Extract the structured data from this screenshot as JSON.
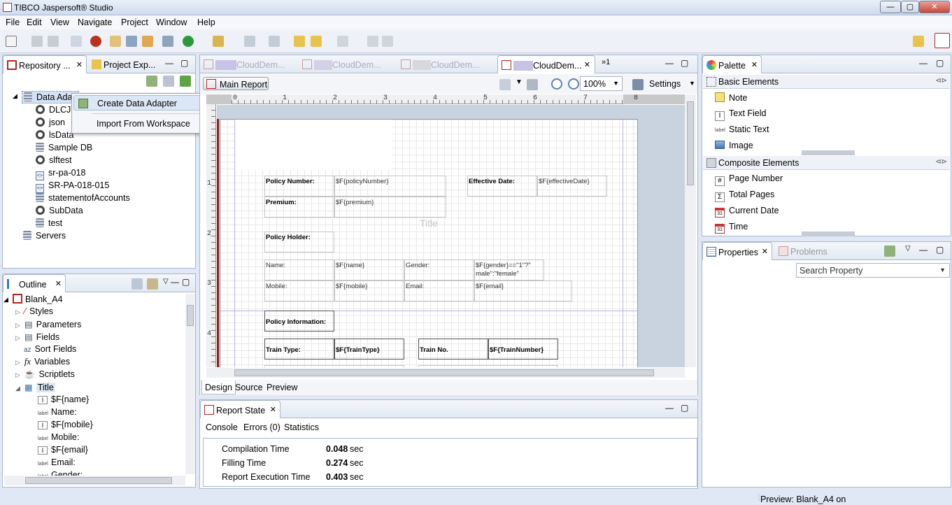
{
  "window": {
    "title": "TIBCO Jaspersoft® Studio",
    "buttons": [
      "—",
      "▢",
      "✕"
    ]
  },
  "menu": [
    "File",
    "Edit",
    "View",
    "Navigate",
    "Project",
    "Window",
    "Help"
  ],
  "repository": {
    "tabs": [
      "Repository ...",
      "Project Exp..."
    ],
    "items": [
      {
        "label": "Data Adap",
        "icon": "db"
      },
      {
        "label": "DLCJS",
        "icon": "ring"
      },
      {
        "label": "json",
        "icon": "ring"
      },
      {
        "label": "lsData",
        "icon": "ring"
      },
      {
        "label": "Sample DB",
        "icon": "db"
      },
      {
        "label": "slftest",
        "icon": "ring"
      },
      {
        "label": "sr-pa-018",
        "icon": "xml"
      },
      {
        "label": "SR-PA-018-015",
        "icon": "xml"
      },
      {
        "label": "statementofAccounts",
        "icon": "db"
      },
      {
        "label": "SubData",
        "icon": "ring"
      },
      {
        "label": "test",
        "icon": "db"
      },
      {
        "label": "Servers",
        "icon": "db"
      }
    ]
  },
  "context_menu": [
    "Create Data Adapter",
    "Import From Workspace"
  ],
  "outline": {
    "tab": "Outline",
    "root": "Blank_A4",
    "items": [
      "Styles",
      "Parameters",
      "Fields",
      "Sort Fields",
      "Variables",
      "Scriptlets",
      "Title"
    ],
    "title_children": [
      {
        "icon": "text",
        "label": "$F{name}"
      },
      {
        "icon": "label",
        "label": "Name:"
      },
      {
        "icon": "text",
        "label": "$F{mobile}"
      },
      {
        "icon": "label",
        "label": "Mobile:"
      },
      {
        "icon": "text",
        "label": "$F{email}"
      },
      {
        "icon": "label",
        "label": "Email:"
      },
      {
        "icon": "label",
        "label": "Gender:"
      }
    ]
  },
  "editor": {
    "tabs": [
      "CloudDem...",
      "CloudDem...",
      "CloudDem...",
      "CloudDem..."
    ],
    "overflow": "»1",
    "main_report": "Main Report",
    "zoom": "100%",
    "settings": "Settings",
    "bottom_tabs": [
      "Design",
      "Source",
      "Preview"
    ],
    "ruler_marks": [
      "0",
      "1",
      "2",
      "3",
      "4",
      "5",
      "6",
      "7",
      "8"
    ],
    "band_title": "Title",
    "fields": {
      "policy_number_label": "Policy Number:",
      "policy_number": "$F{policyNumber}",
      "effective_date_label": "Effective Date:",
      "effective_date": "$F{effectiveDate}",
      "premium_label": "Premium:",
      "premium": "$F{premium}",
      "policy_holder": "Policy Holder:",
      "name_label": "Name:",
      "name": "$F{name}",
      "gender_label": "Gender:",
      "gender": "$F{gender}==\"1\"?\"\nmale\":\"female\"",
      "mobile_label": "Mobile:",
      "mobile": "$F{mobile}",
      "email_label": "Email:",
      "email": "$F{email}",
      "policy_information": "Policy Information:",
      "train_type_label": "Train Type:",
      "train_type": "$F{TrainType}",
      "train_no_label": "Train No.",
      "train_number": "$F{TrainNumber}"
    }
  },
  "report_state": {
    "tab": "Report State",
    "tabs": [
      "Console",
      "Errors (0)",
      "Statistics"
    ],
    "rows": [
      {
        "label": "Compilation Time",
        "value": "0.048",
        "unit": "sec"
      },
      {
        "label": "Filling Time",
        "value": "0.274",
        "unit": "sec"
      },
      {
        "label": "Report Execution Time",
        "value": "0.403",
        "unit": "sec"
      }
    ]
  },
  "palette": {
    "tab": "Palette",
    "basic_header": "Basic Elements",
    "basic": [
      "Note",
      "Text Field",
      "Static Text",
      "Image"
    ],
    "composite_header": "Composite Elements",
    "composite": [
      "Page Number",
      "Total Pages",
      "Current Date",
      "Time"
    ]
  },
  "properties": {
    "tabs": [
      "Properties",
      "Problems"
    ],
    "search_placeholder": "Search Property"
  },
  "status": "Preview: Blank_A4 on"
}
